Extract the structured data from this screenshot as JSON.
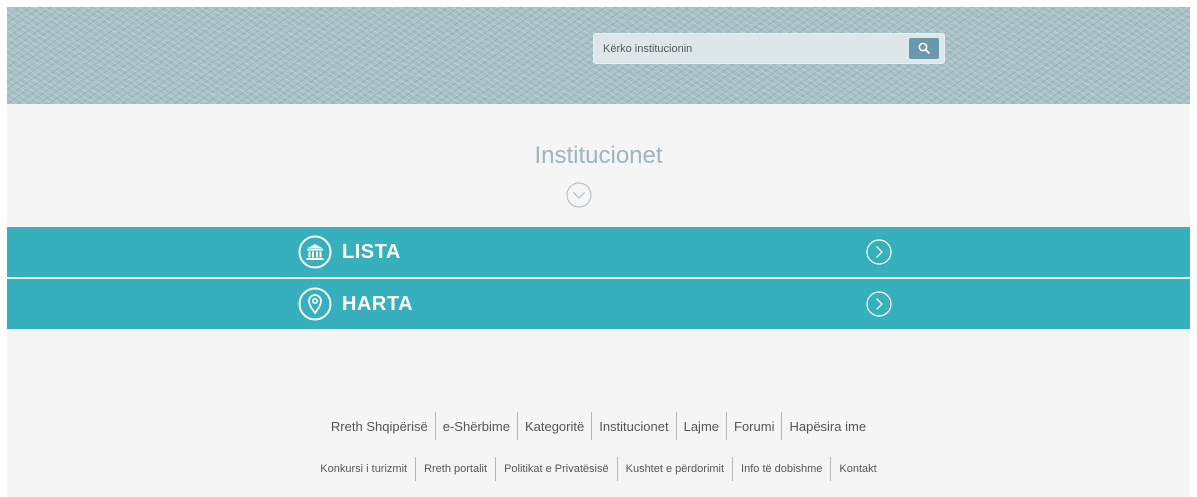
{
  "search": {
    "placeholder": "Kërko institucionin"
  },
  "page": {
    "title": "Institucionet"
  },
  "sections": [
    {
      "label": "LISTA",
      "icon": "institution-icon"
    },
    {
      "label": "HARTA",
      "icon": "map-pin-icon"
    }
  ],
  "footer": {
    "primary_links": [
      "Rreth Shqipërisë",
      "e-Shërbime",
      "Kategoritë",
      "Institucionet",
      "Lajme",
      "Forumi",
      "Hapësira ime"
    ],
    "secondary_links": [
      "Konkursi i turizmit",
      "Rreth portalit",
      "Politikat e Privatësisë",
      "Kushtet e përdorimit",
      "Info të dobishme",
      "Kontakt"
    ]
  },
  "colors": {
    "band": "#37b0bd",
    "title": "#9fb6bc",
    "search_button": "#6c98ad"
  }
}
